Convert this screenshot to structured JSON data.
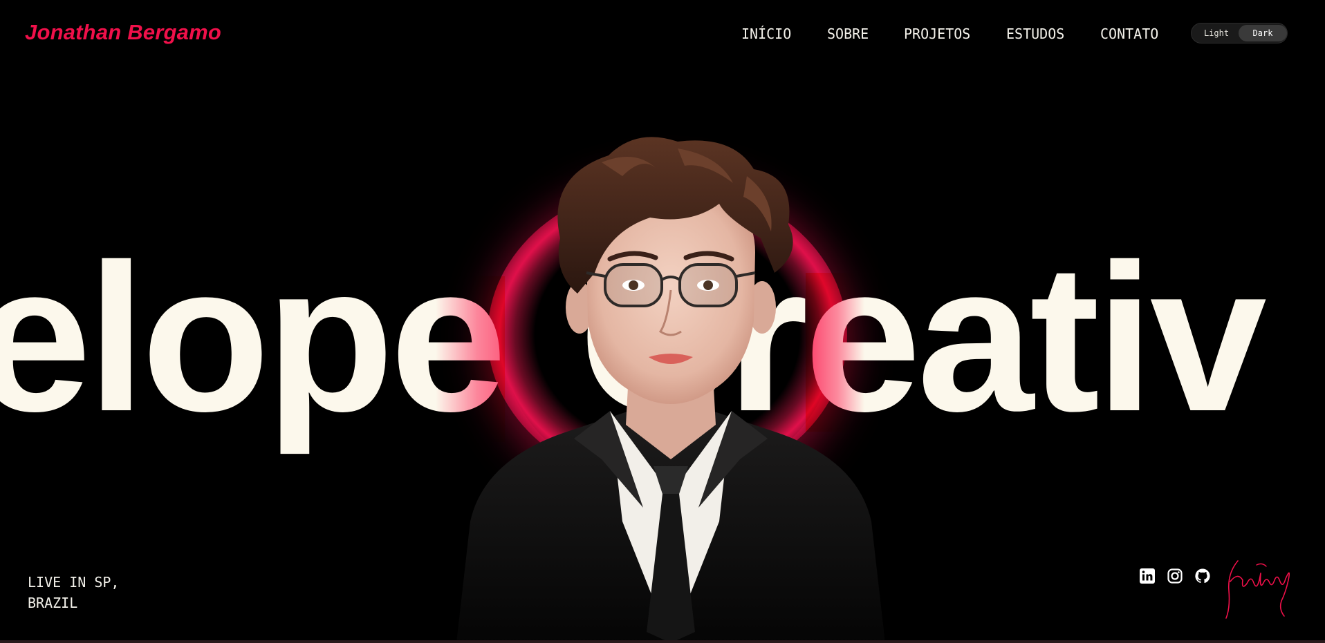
{
  "header": {
    "brand": "Jonathan Bergamo",
    "nav": [
      {
        "label": "INÍCIO"
      },
      {
        "label": "SOBRE"
      },
      {
        "label": "PROJETOS"
      },
      {
        "label": "ESTUDOS"
      },
      {
        "label": "CONTATO"
      }
    ],
    "theme_toggle": {
      "light_label": "Light",
      "dark_label": "Dark",
      "selected": "Dark"
    }
  },
  "hero": {
    "marquee_words": [
      "velope",
      "Creativ"
    ],
    "accent_color": "#f0104a",
    "text_color": "#fcf8ec",
    "background_color": "#000000"
  },
  "footer": {
    "location_line1": "LIVE IN SP,",
    "location_line2": "BRAZIL",
    "socials": [
      {
        "name": "linkedin-icon"
      },
      {
        "name": "instagram-icon"
      },
      {
        "name": "github-icon"
      }
    ],
    "signature_text": "Jonathan B"
  }
}
